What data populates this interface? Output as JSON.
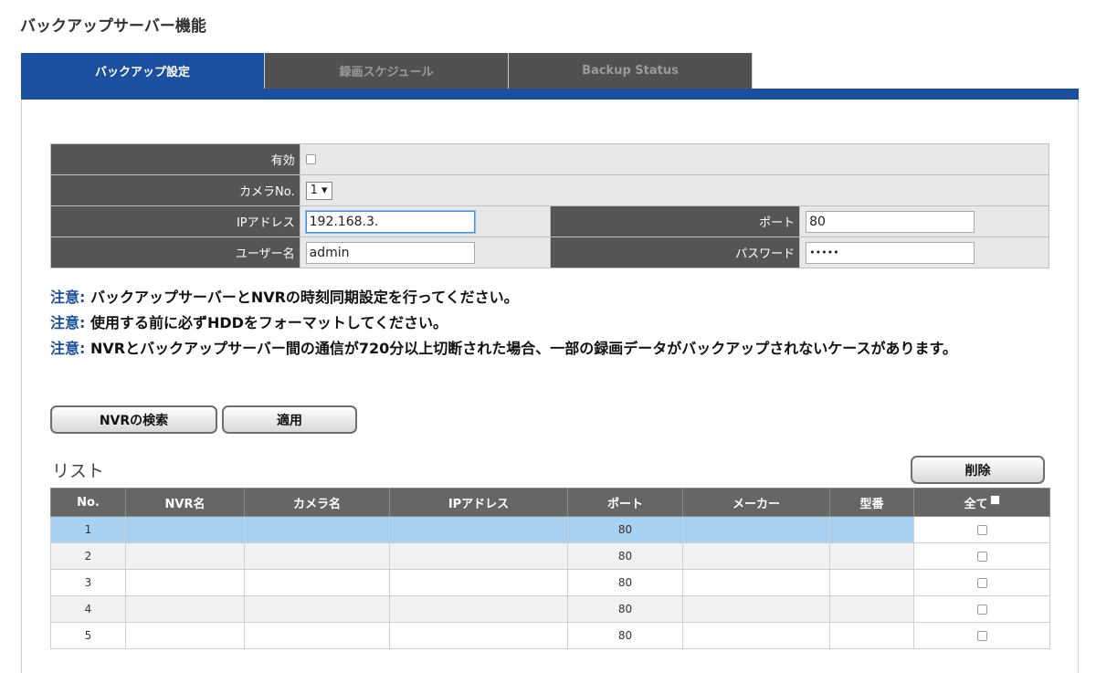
{
  "page_title": "バックアップサーバー機能",
  "tabs": [
    {
      "label": "バックアップ設定",
      "active": true
    },
    {
      "label": "録画スケジュール",
      "active": false
    },
    {
      "label": "Backup Status",
      "active": false
    }
  ],
  "settings": {
    "enabled_label": "有効",
    "enabled_checked": false,
    "camera_label": "カメラNo.",
    "camera_value": "1 ▾",
    "ip_label": "IPアドレス",
    "ip_value": "192.168.3.",
    "port_label": "ポート",
    "port_value": "80",
    "user_label": "ユーザー名",
    "user_value": "admin",
    "password_label": "パスワード",
    "password_value": "•••••"
  },
  "notes": [
    {
      "label": "注意:",
      "text": " バックアップサーバーとNVRの時刻同期設定を行ってください。"
    },
    {
      "label": "注意:",
      "text": " 使用する前に必ずHDDをフォーマットしてください。"
    },
    {
      "label": "注意:",
      "text": " NVRとバックアップサーバー間の通信が720分以上切断された場合、一部の録画データがバックアップされないケースがあります。"
    }
  ],
  "buttons": {
    "search": "NVRの検索",
    "apply": "適用",
    "delete": "削除"
  },
  "list": {
    "title": "リスト",
    "headers": [
      "No.",
      "NVR名",
      "カメラ名",
      "IPアドレス",
      "ポート",
      "メーカー",
      "型番",
      "全て"
    ],
    "rows": [
      {
        "no": "1",
        "nvr": "",
        "camera": "",
        "ip": "",
        "port": "80",
        "maker": "",
        "model": "",
        "selected": true
      },
      {
        "no": "2",
        "nvr": "",
        "camera": "",
        "ip": "",
        "port": "80",
        "maker": "",
        "model": "",
        "selected": false
      },
      {
        "no": "3",
        "nvr": "",
        "camera": "",
        "ip": "",
        "port": "80",
        "maker": "",
        "model": "",
        "selected": false
      },
      {
        "no": "4",
        "nvr": "",
        "camera": "",
        "ip": "",
        "port": "80",
        "maker": "",
        "model": "",
        "selected": false
      },
      {
        "no": "5",
        "nvr": "",
        "camera": "",
        "ip": "",
        "port": "80",
        "maker": "",
        "model": "",
        "selected": false
      }
    ]
  }
}
